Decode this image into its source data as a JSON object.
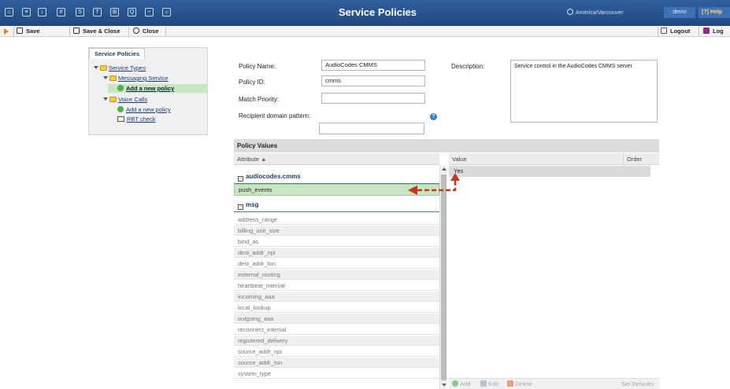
{
  "header": {
    "title": "Service Policies",
    "timezone": "America/Vancouver",
    "user": "demo",
    "help": "Help"
  },
  "toolbar": {
    "save": "Save",
    "save_close": "Save & Close",
    "close": "Close",
    "logout": "Logout",
    "log": "Log"
  },
  "tree": {
    "tab": "Service Policies",
    "service_types": "Service Types",
    "messaging": "Messaging Service",
    "add_policy_1": "Add a new policy",
    "voice_calls": "Voice Calls",
    "add_policy_2": "Add a new policy",
    "rbt_check": "RBT check"
  },
  "form": {
    "policy_name_label": "Policy Name:",
    "policy_name_value": "AudioCodes CMMS",
    "policy_id_label": "Policy ID:",
    "policy_id_value": "cmms",
    "match_priority_label": "Match Priority:",
    "match_priority_value": "",
    "recipient_label": "Recipient domain pattern:",
    "recipient_value": "",
    "description_label": "Description:",
    "description_value": "Service control in the AudioCodes CMMS server"
  },
  "policy_values": {
    "header": "Policy Values",
    "col_attribute": "Attribute",
    "col_value": "Value",
    "col_order": "Order",
    "group1": "audiocodes.cmms",
    "group1_rows": [
      "push_events"
    ],
    "group2": "msg",
    "group2_rows": [
      "address_range",
      "billing_unit_size",
      "bind_as",
      "dest_addr_npi",
      "dest_addr_ton",
      "external_routing",
      "heartbeat_interval",
      "incoming_aaa",
      "local_lookup",
      "outgoing_aaa",
      "reconnect_interval",
      "registered_delivery",
      "source_addr_npi",
      "source_addr_ton",
      "system_type"
    ],
    "selected_value": "Yes",
    "add": "Add",
    "edit": "Edit",
    "delete": "Delete",
    "set_defaults": "Set Defaults"
  },
  "colors": {
    "header_bg": "#2a5694",
    "selection": "#c7e6c1",
    "arrow": "#c0391b"
  }
}
